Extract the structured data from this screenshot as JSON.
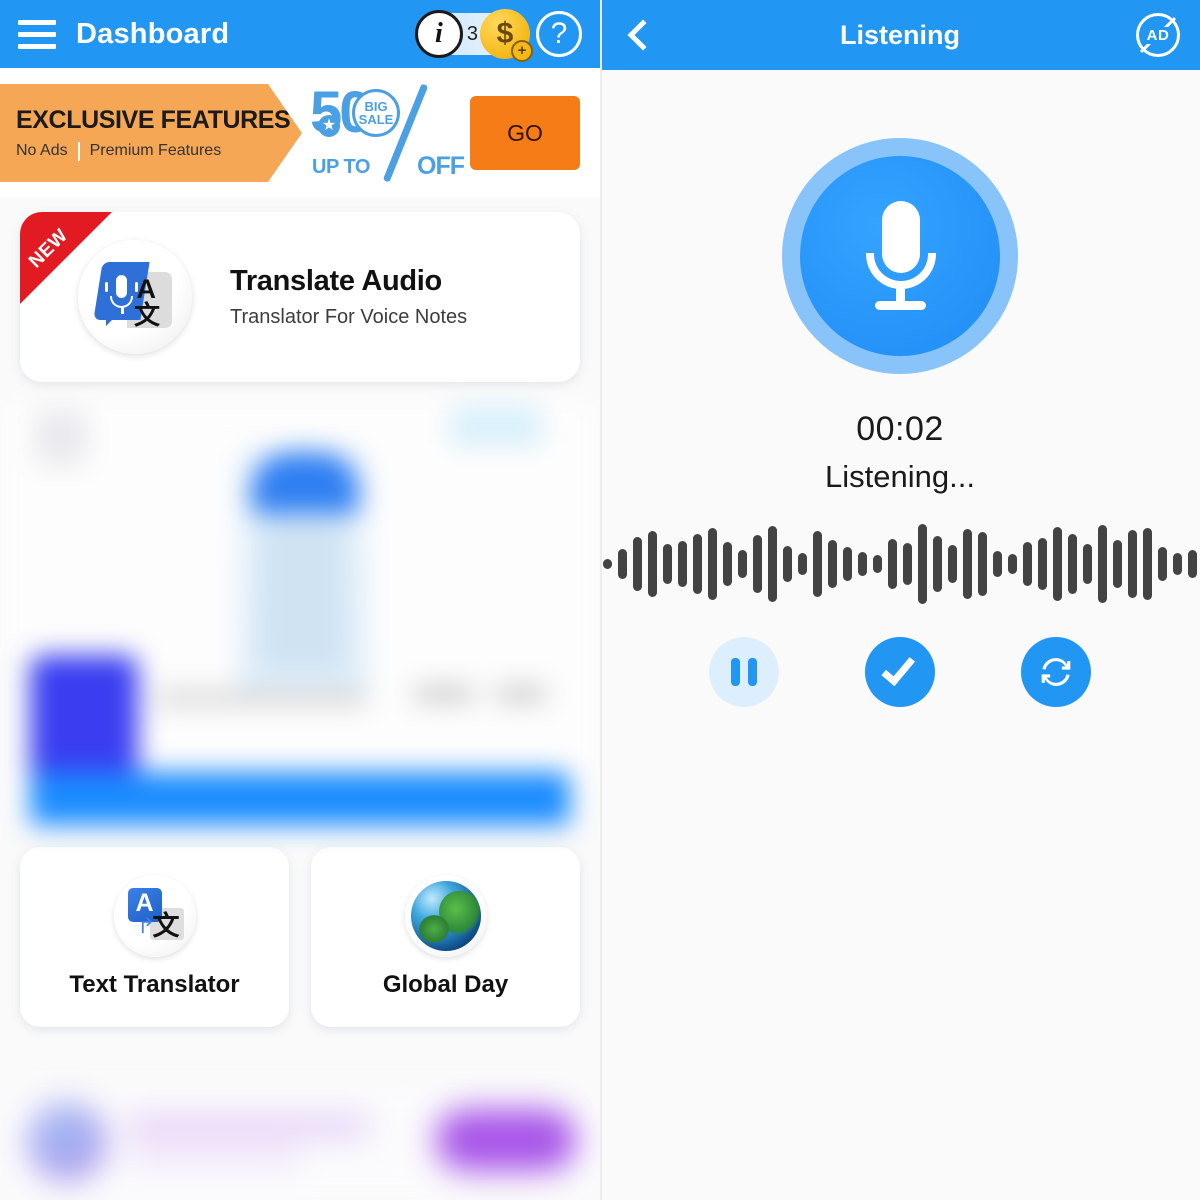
{
  "left": {
    "header": {
      "menu_icon": "hamburger-menu-icon",
      "title": "Dashboard",
      "info_icon": "i",
      "coin_count": "3",
      "coin_icon": "$",
      "coin_plus": "+",
      "help_icon": "?"
    },
    "promo": {
      "title": "EXCLUSIVE FEATURES",
      "sub_left": "No Ads",
      "sub_right": "Premium Features",
      "sale_number": "50",
      "badge_line1": "BIG",
      "badge_line2": "SALE",
      "up_to": "UP TO",
      "off": "OFF",
      "star": "★",
      "go_label": "GO"
    },
    "feature_card": {
      "ribbon": "NEW",
      "title": "Translate Audio",
      "subtitle": "Translator For Voice Notes",
      "icon_letter_a": "A",
      "icon_letter_cn": "文"
    },
    "mini_cards": [
      {
        "label": "Text Translator",
        "icon": "text-translator-icon",
        "letter_a": "A",
        "letter_cn": "文",
        "arrow": "↱"
      },
      {
        "label": "Global Day",
        "icon": "globe-icon"
      }
    ]
  },
  "right": {
    "header": {
      "back_icon": "back-chevron-icon",
      "title": "Listening",
      "ad_icon_label": "AD"
    },
    "mic_button_icon": "microphone-icon",
    "timer": "00:02",
    "status": "Listening...",
    "waveform": {
      "bar_color": "#434343",
      "heights": [
        10,
        30,
        54,
        66,
        40,
        46,
        60,
        72,
        44,
        28,
        58,
        76,
        36,
        22,
        66,
        48,
        34,
        24,
        18,
        50,
        42,
        80,
        56,
        38,
        70,
        64,
        26,
        20,
        44,
        52,
        74,
        60,
        40,
        78,
        48,
        68,
        72,
        34,
        22,
        28
      ]
    },
    "controls": [
      {
        "name": "pause-button",
        "icon": "pause-icon"
      },
      {
        "name": "confirm-button",
        "icon": "check-icon"
      },
      {
        "name": "retry-button",
        "icon": "refresh-icon"
      }
    ]
  },
  "colors": {
    "header_blue": "#2196f3",
    "accent_orange": "#f57c17",
    "banner_orange": "#f5a755",
    "ribbon_red": "#e21b22",
    "wave_gray": "#434343"
  }
}
